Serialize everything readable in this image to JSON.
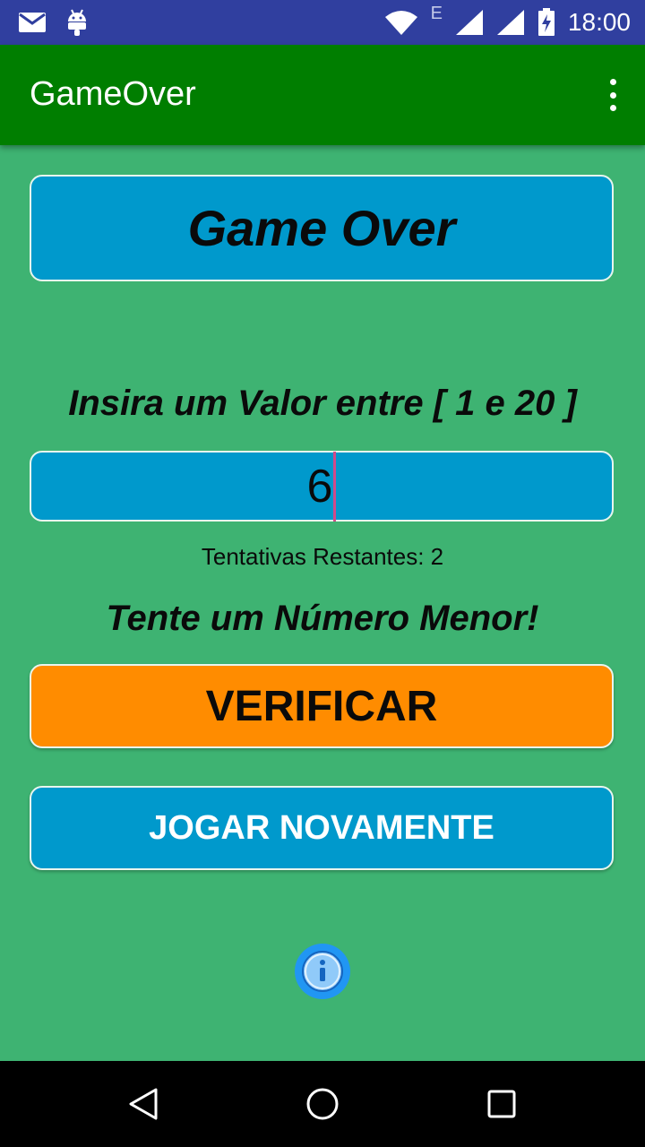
{
  "status_bar": {
    "time": "18:00",
    "network_label": "E",
    "icons": [
      "mail-icon",
      "android-icon",
      "wifi-icon",
      "network-type-icon",
      "signal-icon",
      "signal-icon-2",
      "battery-charging-icon"
    ],
    "color": "#303f9f"
  },
  "app_bar": {
    "title": "GameOver",
    "menu_icon": "more-vert-icon",
    "color": "#007e00"
  },
  "main": {
    "heading": "Game Over",
    "prompt": "Insira um Valor entre [ 1 e 20 ]",
    "input_value": "6",
    "attempts_text": "Tentativas Restantes: 2",
    "hint_text": "Tente um Número Menor!",
    "verify_label": "VERIFICAR",
    "replay_label": "JOGAR NOVAMENTE",
    "info_icon": "info-icon",
    "background_color": "#3eb372",
    "accent_blue": "#0099cc",
    "accent_orange": "#ff8c00"
  },
  "nav_bar": {
    "icons": [
      "back-icon",
      "home-icon",
      "recents-icon"
    ]
  }
}
